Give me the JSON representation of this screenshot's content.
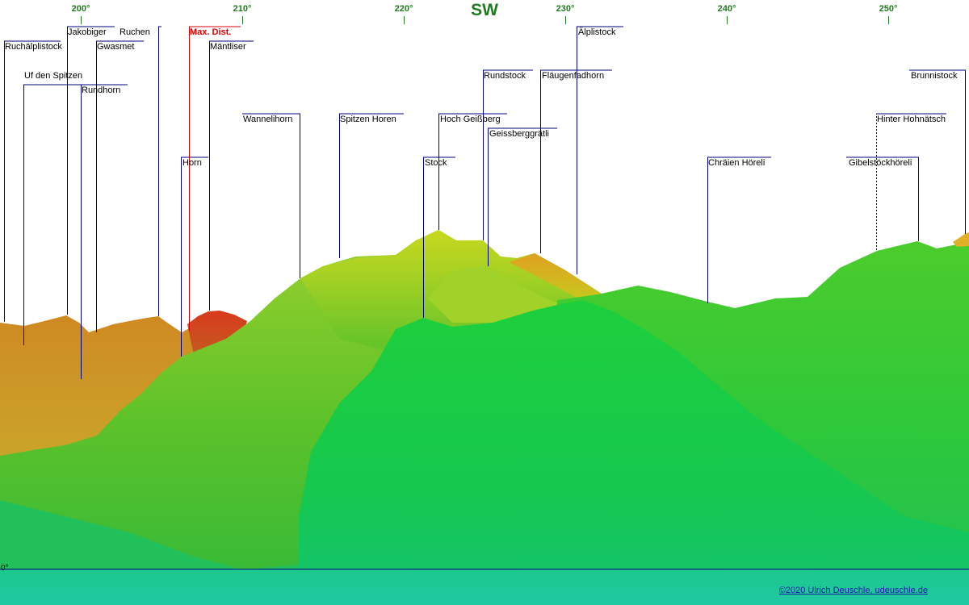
{
  "compass": {
    "degrees": [
      "200°",
      "210°",
      "220°",
      "230°",
      "240°",
      "250°"
    ],
    "cardinal": "SW"
  },
  "horizon_label": "0°",
  "max_distance_label": "Max. Dist.",
  "peaks": [
    "Ruchälplistock",
    "Uf den Spitzen",
    "Jakobiger",
    "Rundhorn",
    "Gwasmet",
    "Ruchen",
    "Horn",
    "Mäntliser",
    "Wannelihorn",
    "Spitzen Horen",
    "Stock",
    "Hoch Geißberg",
    "Rundstock",
    "Geissberggrätli",
    "Fläugenfadhorn",
    "Älplistock",
    "Chräien Höreli",
    "Gibelstöckhöreli",
    "Hinter Hohnätsch",
    "Brunnistock"
  ],
  "credit": "©2020 Ulrich Deuschle, udeuschle.de",
  "colors": {
    "compass": "#1f7a1f",
    "leader_line": "#000080",
    "max_dist": "#dd0000",
    "credit_link": "#1a1aa6",
    "lake": "#20c8a4"
  }
}
